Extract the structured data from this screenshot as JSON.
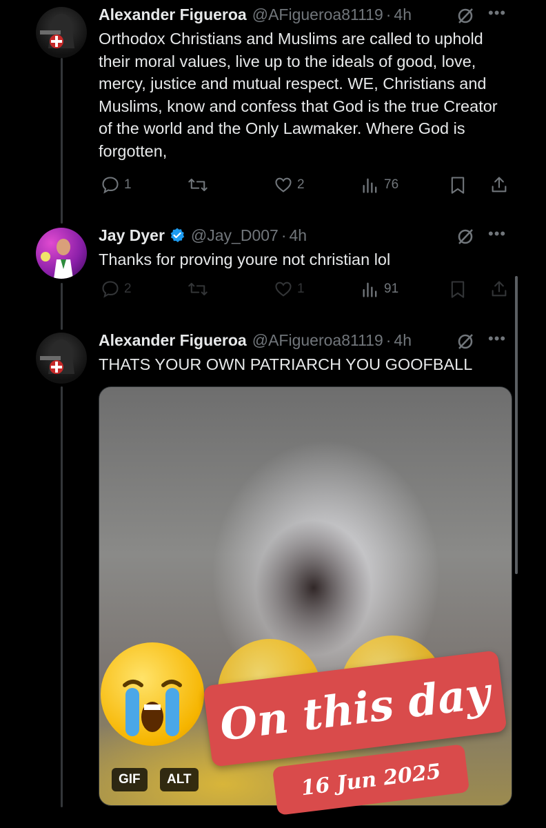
{
  "tweets": [
    {
      "name": "Alexander Figueroa",
      "handle": "@AFigueroa81119",
      "time": "4h",
      "text": "Orthodox Christians and Muslims are called to uphold their moral values, live up to the ideals of good, love, mercy, justice and mutual respect. WE, Christians and Muslims, know and confess that God is the true Creator of the world and the Only Lawmaker. Where God is forgotten,",
      "replies": "1",
      "retweets": "",
      "likes": "2",
      "views": "76"
    },
    {
      "name": "Jay Dyer",
      "handle": "@Jay_D007",
      "time": "4h",
      "verified": true,
      "text": "Thanks for proving youre not christian lol",
      "replies": "2",
      "retweets": "",
      "likes": "1",
      "views": "91"
    },
    {
      "name": "Alexander Figueroa",
      "handle": "@AFigueroa81119",
      "time": "4h",
      "text": "THATS YOUR OWN PATRIARCH YOU GOOFBALL",
      "media": {
        "gif_badge": "GIF",
        "alt_badge": "ALT"
      }
    }
  ],
  "icons": {
    "reply": "reply-icon",
    "retweet": "retweet-icon",
    "like": "heart-icon",
    "views": "views-icon",
    "bookmark": "bookmark-icon",
    "share": "share-icon",
    "grok": "grok-icon",
    "more": "more-icon"
  },
  "colors": {
    "background": "#000000",
    "muted": "#71767b",
    "verified": "#1d9bf0",
    "sticker": "#d94b4b"
  },
  "overlay": {
    "title": "On this day",
    "date": "16 Jun 2025"
  }
}
